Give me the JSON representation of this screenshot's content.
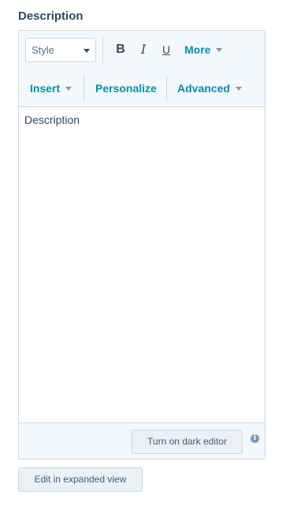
{
  "field": {
    "label": "Description"
  },
  "toolbar": {
    "style_select": {
      "value": "Style",
      "caret_icon": "caret-down-icon"
    },
    "bold_label": "B",
    "italic_label": "I",
    "underline_label": "U",
    "more_label": "More",
    "insert_label": "Insert",
    "personalize_label": "Personalize",
    "advanced_label": "Advanced"
  },
  "editor": {
    "content": "Description"
  },
  "footer": {
    "dark_editor_label": "Turn on dark editor",
    "info_icon": "info-icon",
    "info_glyph": "i"
  },
  "expanded_view_label": "Edit in expanded view",
  "colors": {
    "accent": "#0091ae",
    "text": "#33475b",
    "border": "#cbd6e2",
    "toolbar_bg": "#f5f8fa"
  }
}
